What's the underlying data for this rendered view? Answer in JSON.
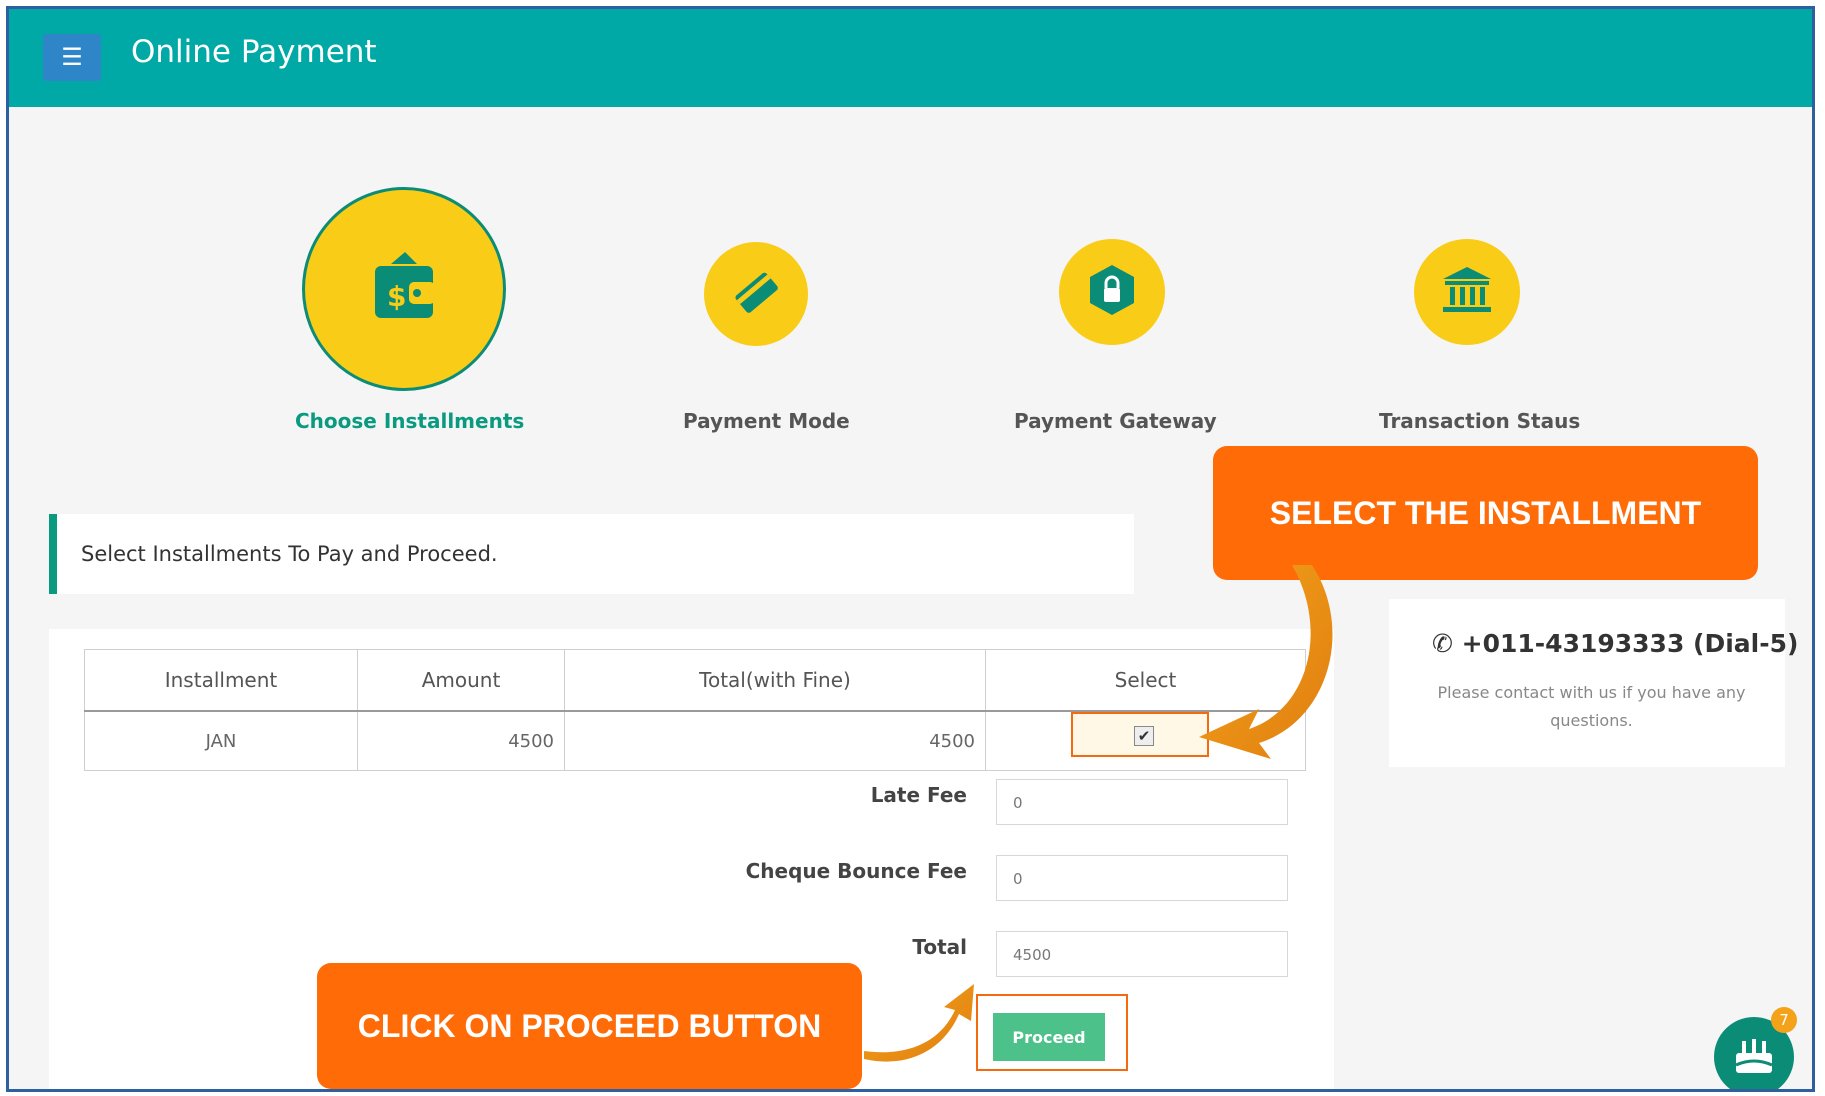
{
  "header": {
    "title": "Online Payment",
    "menu_icon": "hamburger-icon"
  },
  "steps": [
    {
      "label": "Choose Installments",
      "icon": "wallet-dollar-icon",
      "active": true
    },
    {
      "label": "Payment Mode",
      "icon": "card-icon",
      "active": false
    },
    {
      "label": "Payment Gateway",
      "icon": "lock-shield-icon",
      "active": false
    },
    {
      "label": "Transaction Staus",
      "icon": "bank-icon",
      "active": false
    }
  ],
  "panel": {
    "heading": "Select Installments To Pay and Proceed."
  },
  "table": {
    "headers": [
      "Installment",
      "Amount",
      "Total(with Fine)",
      "Select"
    ],
    "rows": [
      {
        "installment": "JAN",
        "amount": "4500",
        "total": "4500",
        "selected": true
      }
    ]
  },
  "fees": {
    "late_fee_label": "Late Fee",
    "late_fee_value": "0",
    "cheque_bounce_label": "Cheque Bounce Fee",
    "cheque_bounce_value": "0",
    "total_label": "Total",
    "total_value": "4500"
  },
  "proceed_label": "Proceed",
  "contact": {
    "phone": "+011-43193333 (Dial-5)",
    "note": "Please contact with us if you have any questions."
  },
  "callouts": {
    "select": "SELECT THE INSTALLMENT",
    "proceed": "CLICK ON PROCEED BUTTON"
  },
  "chat": {
    "badge": "7",
    "icon": "chat-bot-icon"
  },
  "colors": {
    "topbar": "#00a9a6",
    "accent": "#0a9a80",
    "step_circle": "#f9cc18",
    "callout": "#ff6b07",
    "button": "#4cc28a"
  }
}
